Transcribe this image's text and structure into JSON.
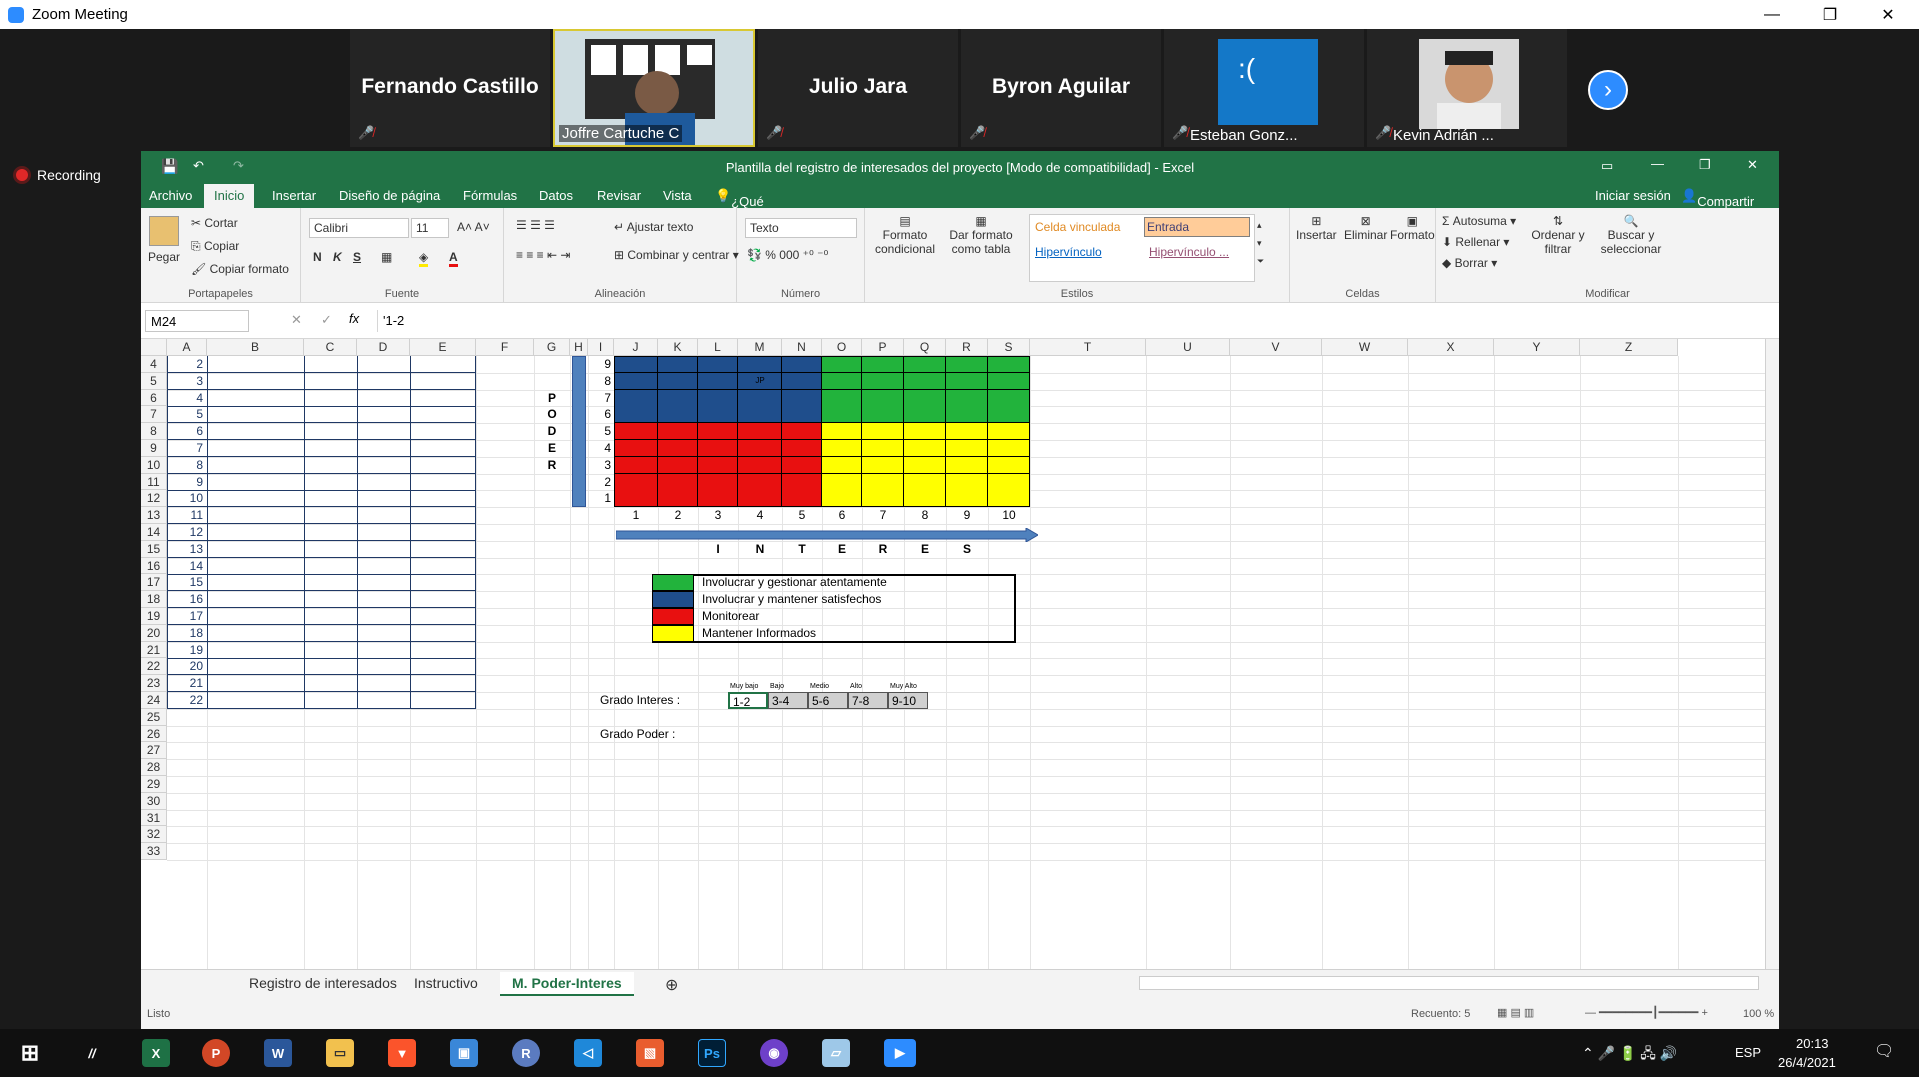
{
  "zoom": {
    "title": "Zoom Meeting",
    "recording": "Recording"
  },
  "participants": [
    {
      "name": "Fernando Castillo",
      "muted": true
    },
    {
      "name": "Joffre Cartuche C",
      "muted": false,
      "video": true
    },
    {
      "name": "Julio Jara",
      "muted": true
    },
    {
      "name": "Byron Aguilar",
      "muted": true
    },
    {
      "name": "Esteban Gonz...",
      "muted": true,
      "video": true
    },
    {
      "name": "Kevin Adrián ...",
      "muted": true,
      "video": true
    }
  ],
  "excel": {
    "title": "Plantilla del registro de interesados del proyecto  [Modo de compatibilidad] - Excel",
    "tabs": [
      "Archivo",
      "Inicio",
      "Insertar",
      "Diseño de página",
      "Fórmulas",
      "Datos",
      "Revisar",
      "Vista",
      "¿Qué desea hacer?"
    ],
    "signin": "Iniciar sesión",
    "share": "Compartir",
    "ribbon": {
      "paste": "Pegar",
      "cut": "Cortar",
      "copy": "Copiar",
      "format_painter": "Copiar formato",
      "clipboard": "Portapapeles",
      "font_name": "Calibri",
      "font_size": "11",
      "font_group": "Fuente",
      "wrap": "Ajustar texto",
      "merge": "Combinar y centrar",
      "alignment": "Alineación",
      "number_format": "Texto",
      "number": "Número",
      "cond_format": "Formato condicional",
      "format_table": "Dar formato como tabla",
      "style1": "Celda vinculada",
      "style2": "Entrada",
      "style3": "Hipervínculo",
      "style4": "Hipervínculo ...",
      "styles": "Estilos",
      "insert": "Insertar",
      "delete": "Eliminar",
      "format": "Formato",
      "cells": "Celdas",
      "autosum": "Autosuma",
      "fill": "Rellenar",
      "clear": "Borrar",
      "sort": "Ordenar y filtrar",
      "find": "Buscar y seleccionar",
      "modify": "Modificar"
    },
    "namebox": "M24",
    "formula": "'1-2",
    "columns": [
      "A",
      "B",
      "C",
      "D",
      "E",
      "F",
      "G",
      "H",
      "I",
      "J",
      "K",
      "L",
      "M",
      "N",
      "O",
      "P",
      "Q",
      "R",
      "S",
      "T",
      "U",
      "V",
      "W",
      "X",
      "Y",
      "Z"
    ],
    "rows": [
      "4",
      "5",
      "6",
      "7",
      "8",
      "9",
      "10",
      "11",
      "12",
      "13",
      "14",
      "15",
      "16",
      "17",
      "18",
      "19",
      "20",
      "21",
      "22",
      "23",
      "24",
      "25",
      "26",
      "27",
      "28",
      "29",
      "30",
      "31",
      "32",
      "33"
    ],
    "col_a_values": [
      "2",
      "3",
      "4",
      "5",
      "6",
      "7",
      "8",
      "9",
      "10",
      "11",
      "12",
      "13",
      "14",
      "15",
      "16",
      "17",
      "18",
      "19",
      "20",
      "21",
      "22"
    ],
    "poder_letters": [
      "P",
      "O",
      "D",
      "E",
      "R"
    ],
    "matrix_y": [
      "9",
      "8",
      "7",
      "6",
      "5",
      "4",
      "3",
      "2",
      "1"
    ],
    "matrix_x": [
      "1",
      "2",
      "3",
      "4",
      "5",
      "6",
      "7",
      "8",
      "9",
      "10"
    ],
    "jp": "JP",
    "interes_letters": [
      "I",
      "N",
      "T",
      "E",
      "R",
      "E",
      "S"
    ],
    "legend": [
      {
        "color": "#22b33c",
        "label": "Involucrar y gestionar atentamente"
      },
      {
        "color": "#1f4e8c",
        "label": "Involucrar y mantener satisfechos"
      },
      {
        "color": "#e81010",
        "label": "Monitorear"
      },
      {
        "color": "#ffff00",
        "label": "Mantener Informados"
      }
    ],
    "grado_interes": "Grado Interes :",
    "grado_poder": "Grado Poder :",
    "scale_headers": [
      "Muy bajo",
      "Bajo",
      "Medio",
      "Alto",
      "Muy Alto"
    ],
    "scale_values": [
      "1-2",
      "3-4",
      "5-6",
      "7-8",
      "9-10"
    ],
    "sheet_tabs": [
      "Registro de interesados",
      "Instructivo",
      "M. Poder-Interes"
    ],
    "status_left": "Listo",
    "status_count": "Recuento: 5",
    "zoom_level": "100 %"
  },
  "taskbar": {
    "lang": "ESP",
    "time": "20:13",
    "date": "26/4/2021"
  }
}
